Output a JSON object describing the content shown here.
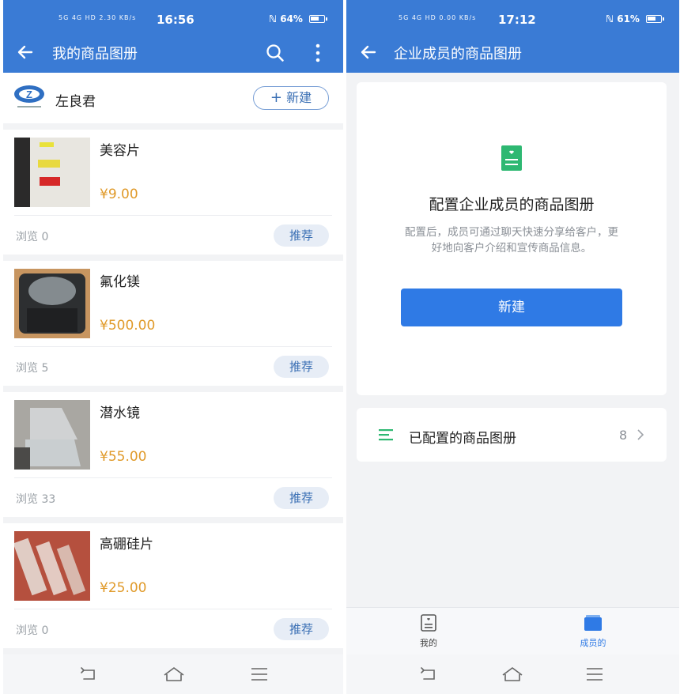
{
  "left": {
    "status": {
      "signal": "5G 4G HD 2.30 KB/s",
      "time": "16:56",
      "battery": "64%"
    },
    "title": "我的商品图册",
    "user": {
      "name": "左良君",
      "logo_letter": "Z"
    },
    "new_label": "新建",
    "products": [
      {
        "name": "美容片",
        "price": "¥9.00",
        "views": "浏览 0",
        "action": "推荐"
      },
      {
        "name": "氟化镁",
        "price": "¥500.00",
        "views": "浏览 5",
        "action": "推荐"
      },
      {
        "name": "潜水镜",
        "price": "¥55.00",
        "views": "浏览 33",
        "action": "推荐"
      },
      {
        "name": "高硼硅片",
        "price": "¥25.00",
        "views": "浏览 0",
        "action": "推荐"
      }
    ]
  },
  "right": {
    "status": {
      "signal": "5G 4G HD 0.00 KB/s",
      "time": "17:12",
      "battery": "61%"
    },
    "title": "企业成员的商品图册",
    "setup": {
      "heading": "配置企业成员的商品图册",
      "desc_line1": "配置后，成员可通过聊天快速分享给客户，更",
      "desc_line2": "好地向客户介绍和宣传商品信息。",
      "button": "新建"
    },
    "configured": {
      "label": "已配置的商品图册",
      "count": "8"
    },
    "tabs": [
      {
        "label": "我的",
        "active": false
      },
      {
        "label": "成员的",
        "active": true
      }
    ]
  },
  "colors": {
    "primary": "#3a7bd5",
    "price": "#e09a2a",
    "green": "#2eb872"
  }
}
